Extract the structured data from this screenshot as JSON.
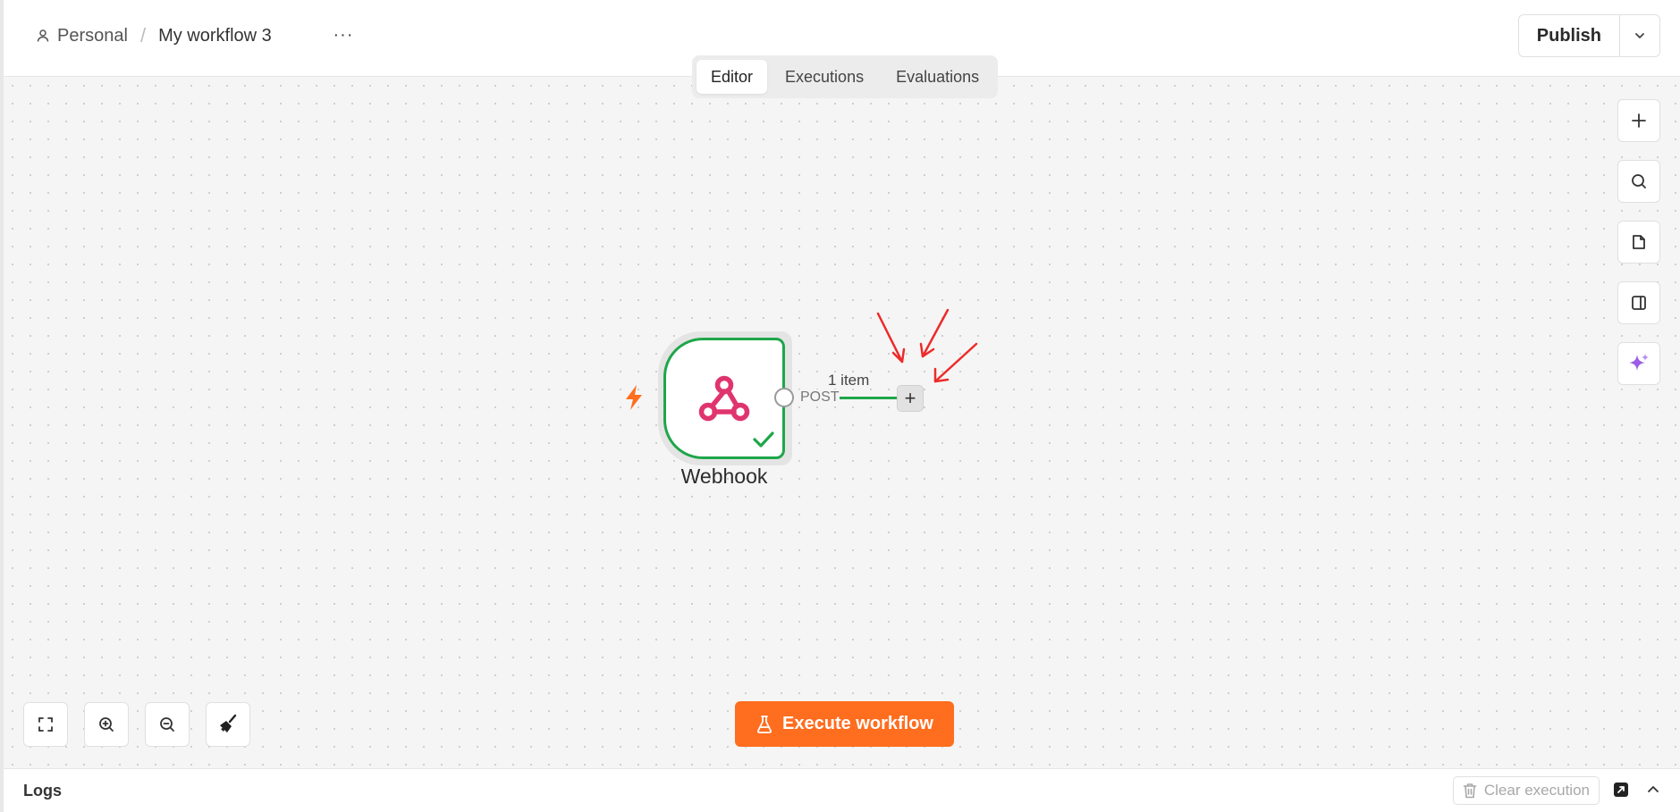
{
  "header": {
    "project_label": "Personal",
    "separator": "/",
    "workflow_name": "My workflow 3",
    "more_label": "···",
    "publish_label": "Publish"
  },
  "tabs": [
    {
      "label": "Editor",
      "active": true
    },
    {
      "label": "Executions",
      "active": false
    },
    {
      "label": "Evaluations",
      "active": false
    }
  ],
  "canvas": {
    "node": {
      "name": "Webhook",
      "icon": "webhook-icon",
      "status": "success",
      "output_label": "POST"
    },
    "edge": {
      "items_label": "1 item"
    },
    "add_node_label": "+"
  },
  "right_toolbar": [
    {
      "name": "add-node",
      "icon": "plus-icon"
    },
    {
      "name": "search",
      "icon": "search-icon"
    },
    {
      "name": "sticky-note",
      "icon": "note-icon"
    },
    {
      "name": "toggle-panel",
      "icon": "panel-icon"
    },
    {
      "name": "ai-assistant",
      "icon": "sparkle-icon"
    }
  ],
  "bottom_controls": [
    {
      "name": "fit-view",
      "icon": "fullscreen-icon"
    },
    {
      "name": "zoom-in",
      "icon": "zoom-in-icon"
    },
    {
      "name": "zoom-out",
      "icon": "zoom-out-icon"
    },
    {
      "name": "tidy-up",
      "icon": "broom-icon"
    }
  ],
  "execute_label": "Execute workflow",
  "logs": {
    "title": "Logs",
    "clear_label": "Clear execution"
  },
  "colors": {
    "accent": "#ff6d1f",
    "success": "#1fa64a",
    "webhook": "#e0346e",
    "ai": "#9b5de5",
    "annotation": "#ee2a2a"
  }
}
